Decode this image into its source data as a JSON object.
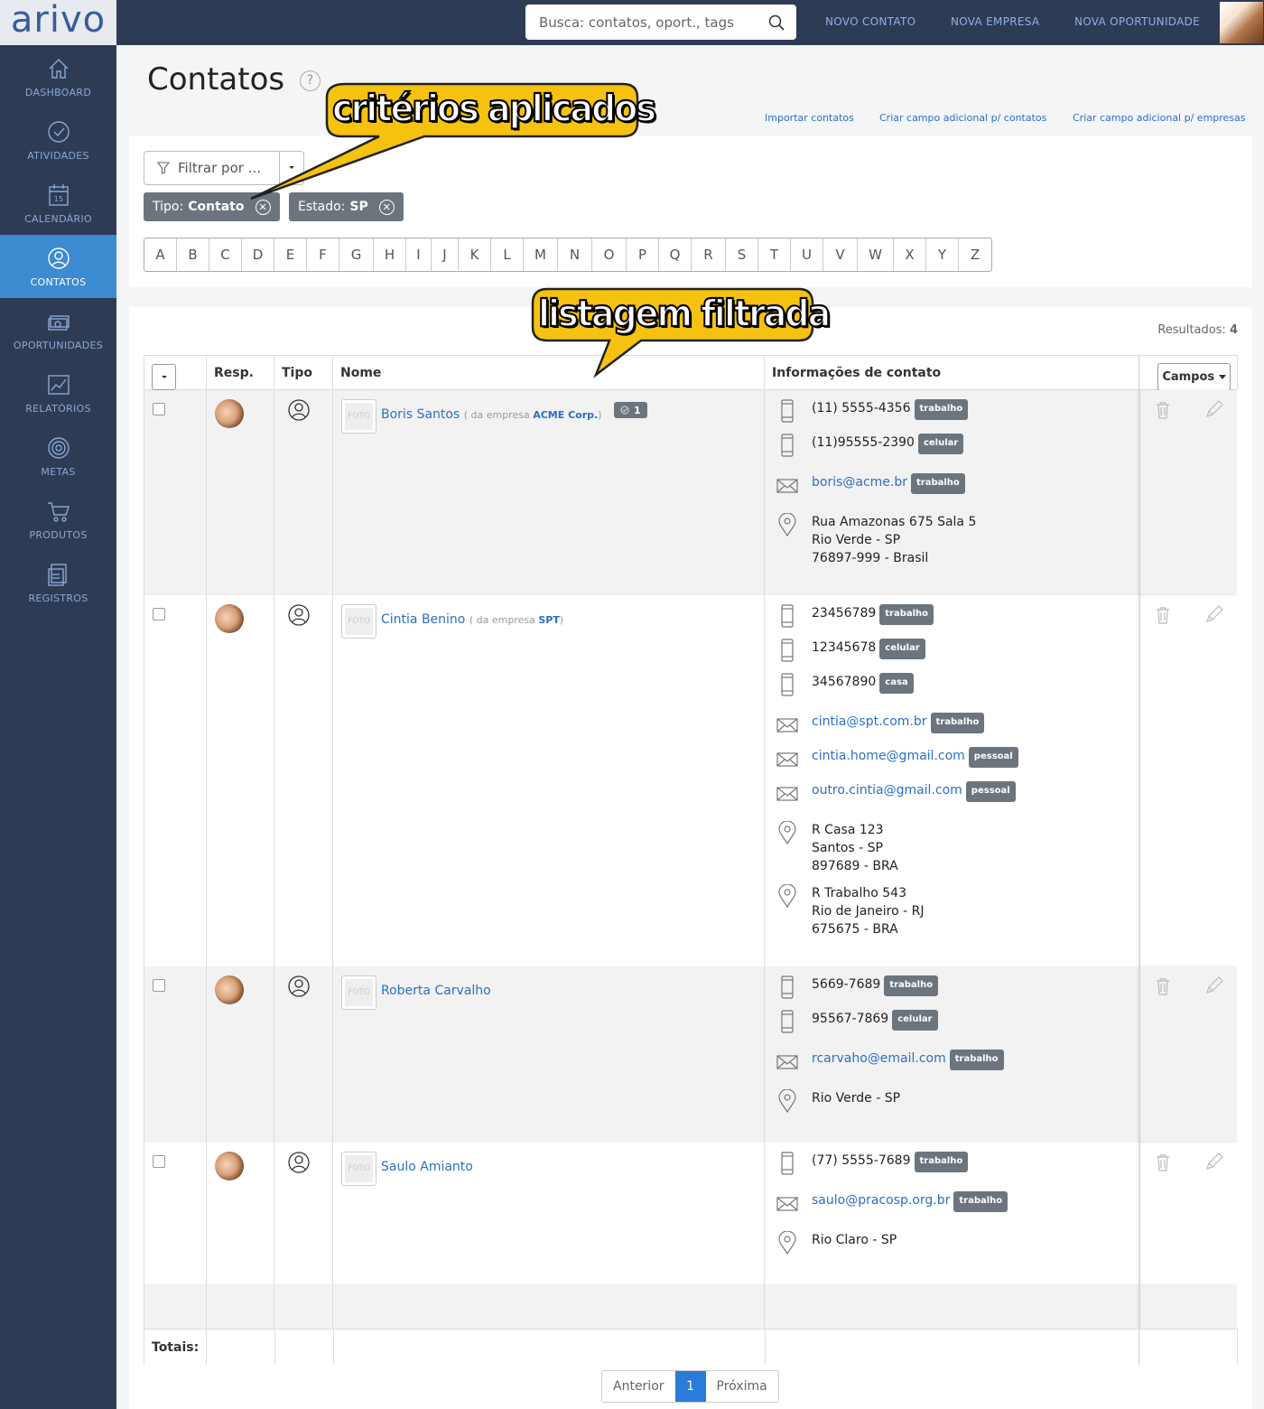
{
  "app": {
    "logo": "arivo"
  },
  "nav": {
    "items": [
      {
        "id": "dashboard",
        "label": "DASHBOARD",
        "icon": "home-icon"
      },
      {
        "id": "atividades",
        "label": "ATIVIDADES",
        "icon": "check-circle-icon"
      },
      {
        "id": "calendario",
        "label": "CALENDÁRIO",
        "icon": "calendar-icon",
        "day": "15"
      },
      {
        "id": "contatos",
        "label": "CONTATOS",
        "icon": "user-icon",
        "active": true
      },
      {
        "id": "oportunidades",
        "label": "OPORTUNIDADES",
        "icon": "money-icon"
      },
      {
        "id": "relatorios",
        "label": "RELATÓRIOS",
        "icon": "chart-icon"
      },
      {
        "id": "metas",
        "label": "METAS",
        "icon": "target-icon"
      },
      {
        "id": "produtos",
        "label": "PRODUTOS",
        "icon": "cart-icon"
      },
      {
        "id": "registros",
        "label": "REGISTROS",
        "icon": "records-icon"
      }
    ]
  },
  "topbar": {
    "search_placeholder": "Busca: contatos, oport., tags",
    "novo_contato": "NOVO CONTATO",
    "nova_empresa": "NOVA EMPRESA",
    "nova_oportunidade": "NOVA OPORTUNIDADE"
  },
  "page": {
    "title": "Contatos",
    "help": "?",
    "links": {
      "importar": "Importar contatos",
      "campo_contatos": "Criar campo adicional p/ contatos",
      "campo_empresas": "Criar campo adicional p/ empresas"
    }
  },
  "filter": {
    "button_label": "Filtrar por ...",
    "chips": [
      {
        "label": "Tipo:",
        "value": "Contato"
      },
      {
        "label": "Estado:",
        "value": "SP"
      }
    ],
    "letters": [
      "A",
      "B",
      "C",
      "D",
      "E",
      "F",
      "G",
      "H",
      "I",
      "J",
      "K",
      "L",
      "M",
      "N",
      "O",
      "P",
      "Q",
      "R",
      "S",
      "T",
      "U",
      "V",
      "W",
      "X",
      "Y",
      "Z"
    ]
  },
  "annotations": {
    "criteria": "critérios aplicados",
    "listing": "listagem filtrada"
  },
  "results": {
    "label": "Resultados:",
    "count": "4"
  },
  "table": {
    "headers": {
      "resp": "Resp.",
      "tipo": "Tipo",
      "nome": "Nome",
      "info": "Informações de contato",
      "campos": "Campos"
    },
    "foto_placeholder": "FOTO",
    "company_prefix": "( da empresa",
    "company_suffix": ")",
    "rows": [
      {
        "name": "Boris Santos",
        "company": "ACME Corp.",
        "badge": "1",
        "phones": [
          {
            "v": "(11) 5555-4356",
            "t": "trabalho"
          },
          {
            "v": "(11)95555-2390",
            "t": "celular"
          }
        ],
        "emails": [
          {
            "v": "boris@acme.br",
            "t": "trabalho"
          }
        ],
        "addresses": [
          [
            "Rua Amazonas 675 Sala 5",
            "Rio Verde - SP",
            "76897-999 - Brasil"
          ]
        ]
      },
      {
        "name": "Cintia Benino",
        "company": "SPT",
        "badge": "",
        "phones": [
          {
            "v": "23456789",
            "t": "trabalho"
          },
          {
            "v": "12345678",
            "t": "celular"
          },
          {
            "v": "34567890",
            "t": "casa"
          }
        ],
        "emails": [
          {
            "v": "cintia@spt.com.br",
            "t": "trabalho"
          },
          {
            "v": "cintia.home@gmail.com",
            "t": "pessoal"
          },
          {
            "v": "outro.cintia@gmail.com",
            "t": "pessoal"
          }
        ],
        "addresses": [
          [
            "R Casa 123",
            "Santos - SP",
            "897689 - BRA"
          ],
          [
            "R Trabalho 543",
            "Rio de Janeiro - RJ",
            "675675 - BRA"
          ]
        ]
      },
      {
        "name": "Roberta Carvalho",
        "company": "",
        "badge": "",
        "phones": [
          {
            "v": "5669-7689",
            "t": "trabalho"
          },
          {
            "v": "95567-7869",
            "t": "celular"
          }
        ],
        "emails": [
          {
            "v": "rcarvaho@email.com",
            "t": "trabalho"
          }
        ],
        "addresses": [
          [
            "Rio Verde - SP"
          ]
        ]
      },
      {
        "name": "Saulo Amianto",
        "company": "",
        "badge": "",
        "phones": [
          {
            "v": "(77) 5555-7689",
            "t": "trabalho"
          }
        ],
        "emails": [
          {
            "v": "saulo@pracosp.org.br",
            "t": "trabalho"
          }
        ],
        "addresses": [
          [
            "Rio Claro - SP"
          ]
        ]
      }
    ],
    "totals_label": "Totais:"
  },
  "pager": {
    "prev": "Anterior",
    "current": "1",
    "next": "Próxima"
  }
}
